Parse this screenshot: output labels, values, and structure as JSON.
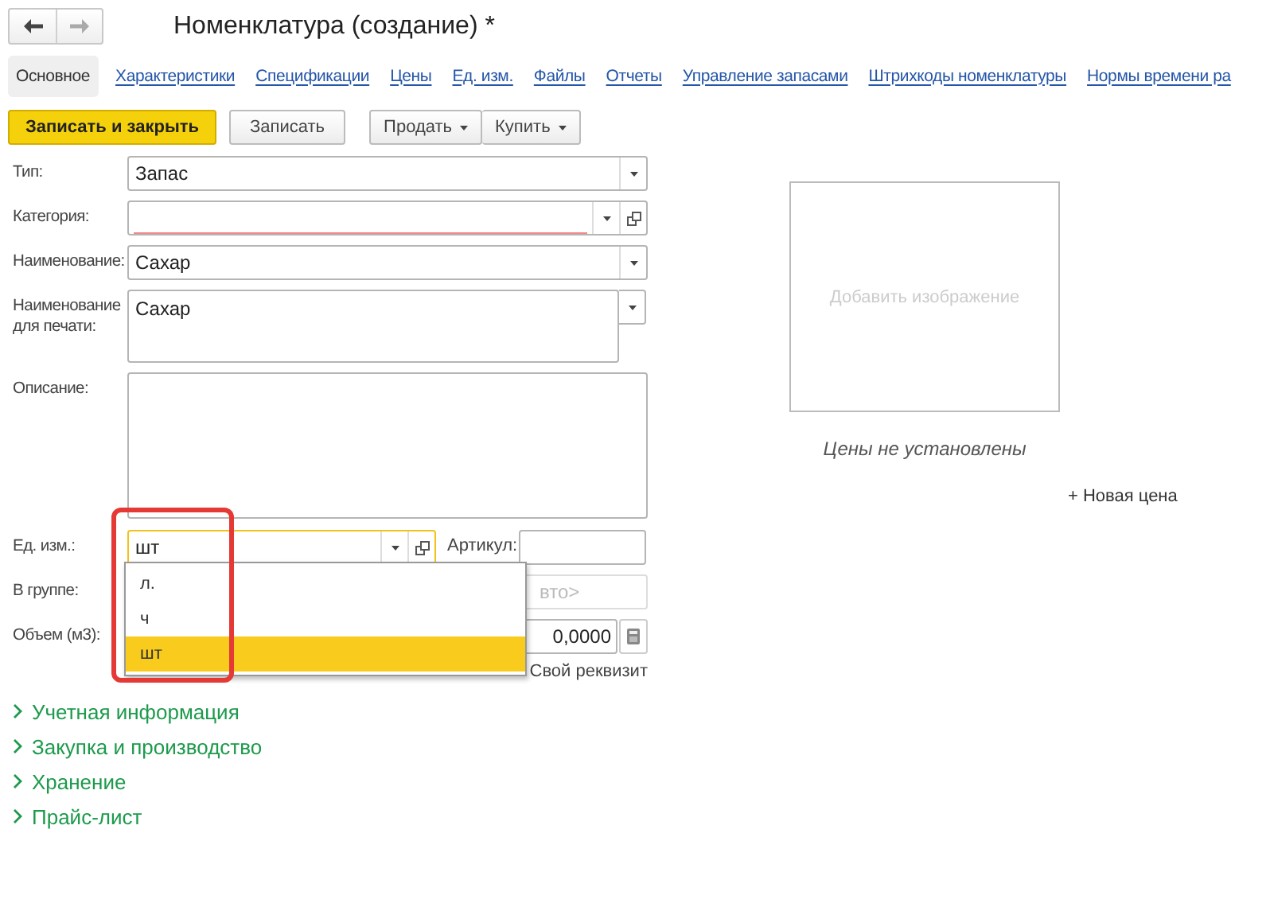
{
  "nav": {
    "back_enabled": true,
    "forward_enabled": false
  },
  "title": "Номенклатура (создание) *",
  "tabs": [
    {
      "label": "Основное",
      "selected": true
    },
    {
      "label": "Характеристики",
      "selected": false
    },
    {
      "label": "Спецификации",
      "selected": false
    },
    {
      "label": "Цены",
      "selected": false
    },
    {
      "label": "Ед. изм.",
      "selected": false
    },
    {
      "label": "Файлы",
      "selected": false
    },
    {
      "label": "Отчеты",
      "selected": false
    },
    {
      "label": "Управление запасами",
      "selected": false
    },
    {
      "label": "Штрихкоды номенклатуры",
      "selected": false
    },
    {
      "label": "Нормы времени ра",
      "selected": false
    }
  ],
  "actions": [
    {
      "label": "Записать и закрыть",
      "kind": "primary"
    },
    {
      "label": "Записать",
      "kind": "plain"
    },
    {
      "label": "Продать",
      "kind": "menu"
    },
    {
      "label": "Купить",
      "kind": "menu"
    }
  ],
  "fields": [
    {
      "kind": "select",
      "label": "Тип:",
      "value": "Запас"
    },
    {
      "kind": "select_open",
      "label": "Категория:",
      "required": true
    },
    {
      "kind": "select",
      "label": "Наименование:",
      "value": "Сахар"
    },
    {
      "kind": "textarea_select",
      "label": "Наименование для печати:",
      "value": "Сахар"
    },
    {
      "kind": "textarea",
      "label": "Описание:"
    },
    {
      "kind": "unit",
      "label": "Ед. изм.:",
      "value": "шт",
      "focused": true,
      "extra_label": "Артикул:"
    },
    {
      "kind": "disabled",
      "label": "В группе:",
      "placeholder": "вто>"
    },
    {
      "kind": "number",
      "label": "Объем (м3):",
      "value": "0,0000"
    },
    {
      "kind": "link",
      "text": "Свой реквизит"
    }
  ],
  "dropdown": {
    "items": [
      {
        "label": "л.",
        "selected": false
      },
      {
        "label": "ч",
        "selected": false
      },
      {
        "label": "шт",
        "selected": true
      }
    ]
  },
  "image_placeholder": "Добавить изображение",
  "prices_note": "Цены не установлены",
  "new_price_link": "+ Новая цена",
  "groups": [
    {
      "label": "Учетная информация",
      "expanded": false
    },
    {
      "label": "Закупка и производство",
      "expanded": false
    },
    {
      "label": "Хранение",
      "expanded": false
    },
    {
      "label": "Прайс-лист",
      "expanded": false
    }
  ]
}
